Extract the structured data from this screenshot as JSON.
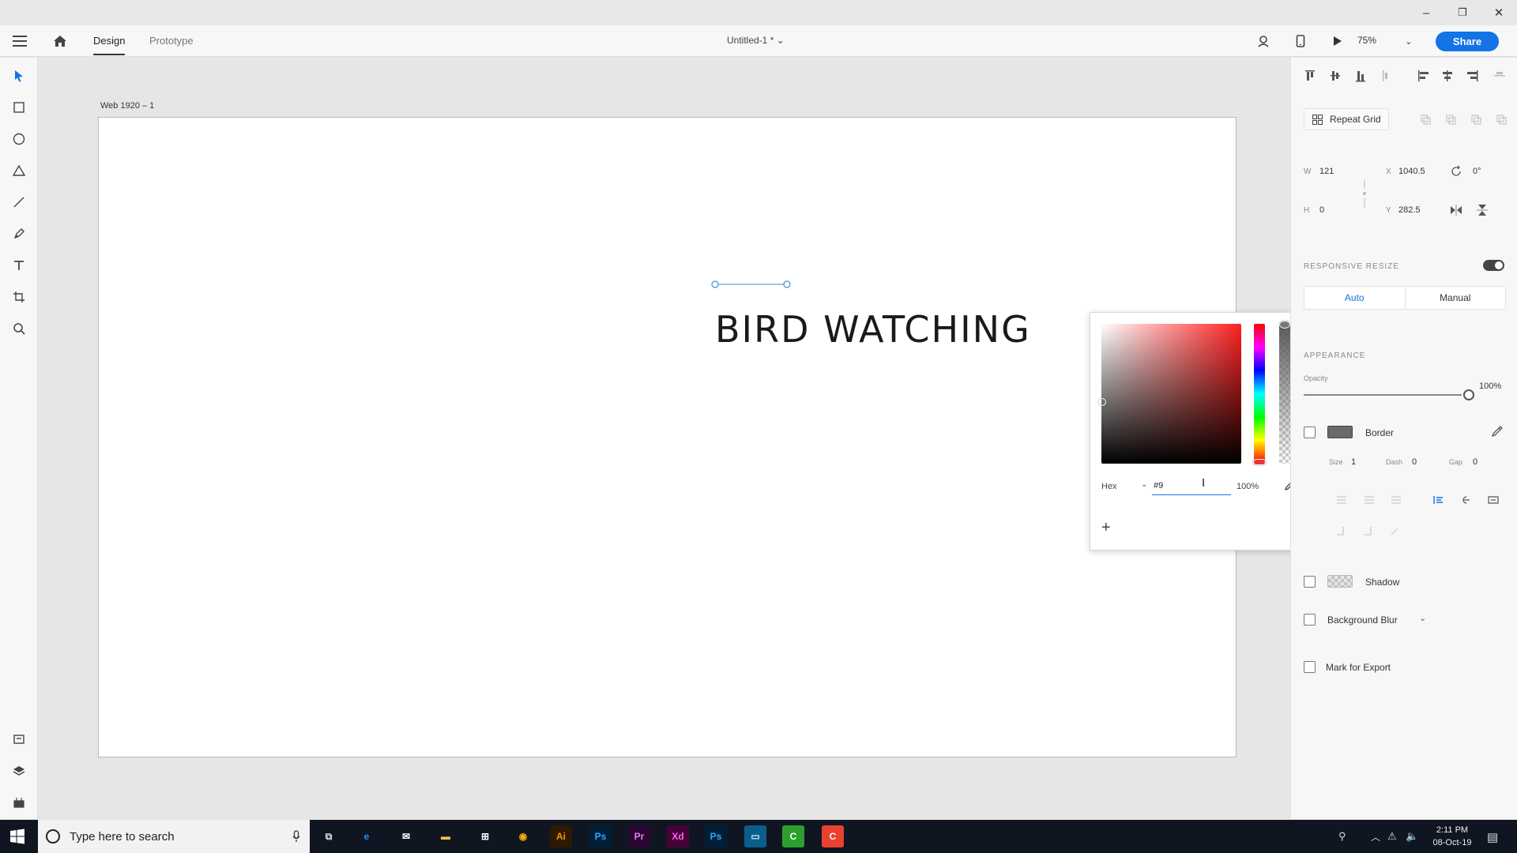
{
  "window": {
    "minimize_glyph": "–",
    "restore_glyph": "❐",
    "close_glyph": "✕"
  },
  "header": {
    "tabs": [
      {
        "label": "Design",
        "active": true
      },
      {
        "label": "Prototype",
        "active": false
      }
    ],
    "document_title": "Untitled-1 * ⌄",
    "zoom": "75%",
    "share_label": "Share",
    "accent": "#1473e6"
  },
  "canvas": {
    "artboard_label": "Web 1920 – 1",
    "headline": "BIRD WATCHING"
  },
  "color_picker": {
    "mode_label": "Hex",
    "hex_value": "#9",
    "opacity": "100%",
    "add_label": "+",
    "hue_color": "#ff2020"
  },
  "panel": {
    "repeat_grid_label": "Repeat Grid",
    "w_label": "W",
    "w_value": "121",
    "h_label": "H",
    "h_value": "0",
    "x_label": "X",
    "x_value": "1040.5",
    "y_label": "Y",
    "y_value": "282.5",
    "rotation": "0°",
    "responsive_title": "RESPONSIVE RESIZE",
    "resize_options": [
      "Auto",
      "Manual"
    ],
    "appearance_title": "APPEARANCE",
    "opacity_label": "Opacity",
    "opacity_value": "100%",
    "border_label": "Border",
    "size_label": "Size",
    "size_value": "1",
    "dash_label": "Dash",
    "dash_value": "0",
    "gap_label": "Gap",
    "gap_value": "0",
    "shadow_label": "Shadow",
    "blur_label": "Background Blur",
    "export_label": "Mark for Export"
  },
  "taskbar": {
    "search_placeholder": "Type here to search",
    "apps": [
      {
        "name": "task-view",
        "label": "⧉",
        "bg": "#101522",
        "fg": "#ddd"
      },
      {
        "name": "edge",
        "label": "e",
        "bg": "#101522",
        "fg": "#1e90ff"
      },
      {
        "name": "mail",
        "label": "✉",
        "bg": "#101522",
        "fg": "#fff"
      },
      {
        "name": "file-explorer",
        "label": "▬",
        "bg": "#101522",
        "fg": "#f5c242"
      },
      {
        "name": "store",
        "label": "⊞",
        "bg": "#101522",
        "fg": "#fff"
      },
      {
        "name": "chrome",
        "label": "◉",
        "bg": "#101522",
        "fg": "#f4b400"
      },
      {
        "name": "illustrator",
        "label": "Ai",
        "bg": "#2e1a00",
        "fg": "#ff9a00"
      },
      {
        "name": "photoshop",
        "label": "Ps",
        "bg": "#001e36",
        "fg": "#31a8ff"
      },
      {
        "name": "premiere",
        "label": "Pr",
        "bg": "#2a0633",
        "fg": "#e77cf9"
      },
      {
        "name": "adobe-xd",
        "label": "Xd",
        "bg": "#470137",
        "fg": "#ff61f6"
      },
      {
        "name": "photoshop-2",
        "label": "Ps",
        "bg": "#001e36",
        "fg": "#31a8ff"
      },
      {
        "name": "app-blue",
        "label": "▭",
        "bg": "#0a5e8a",
        "fg": "#bfe9ff"
      },
      {
        "name": "app-green",
        "label": "C",
        "bg": "#2ca02c",
        "fg": "#fff"
      },
      {
        "name": "app-red",
        "label": "C",
        "bg": "#e8412e",
        "fg": "#fff"
      }
    ],
    "time": "2:11 PM",
    "date": "08-Oct-19"
  }
}
